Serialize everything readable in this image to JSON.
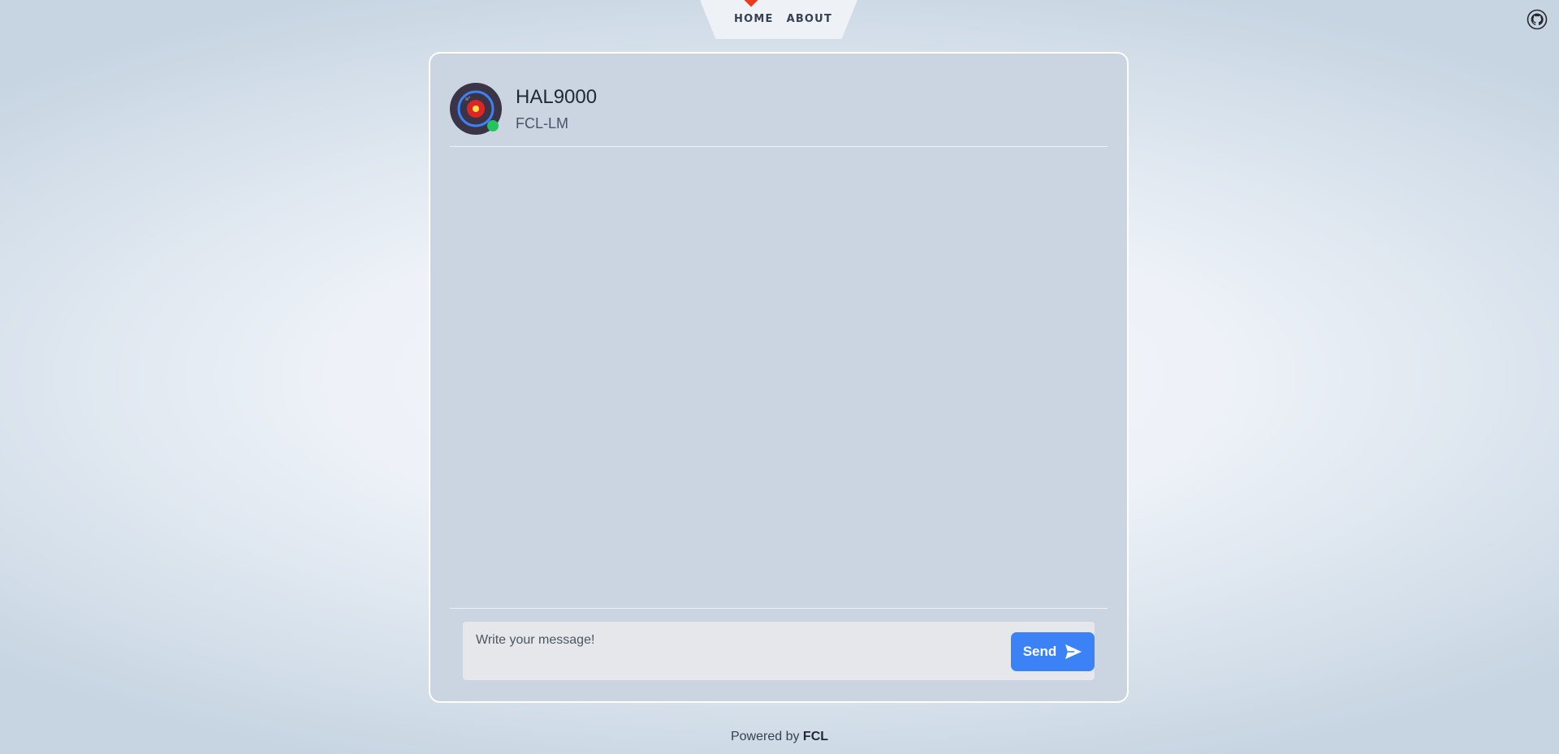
{
  "nav": {
    "home_label": "HOME",
    "about_label": "ABOUT"
  },
  "chat": {
    "bot_name": "HAL9000",
    "bot_model": "FCL-LM",
    "status": "online",
    "input_placeholder": "Write your message!",
    "input_value": "",
    "send_label": "Send"
  },
  "footer": {
    "powered_by_prefix": "Powered by",
    "powered_by_brand": "FCL"
  },
  "icons": {
    "github": "github-icon",
    "send": "send-arrow-icon",
    "avatar": "hal-eye-avatar"
  },
  "colors": {
    "accent": "#3b82f6",
    "nav_marker": "#ea3b1e",
    "online": "#22c55e",
    "card_bg": "#cbd5e1"
  }
}
